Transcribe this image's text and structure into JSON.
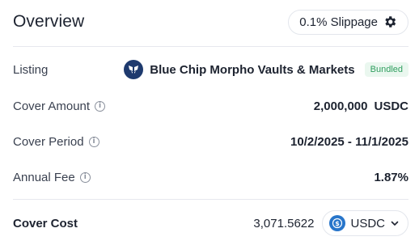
{
  "header": {
    "title": "Overview",
    "slippage_label": "0.1% Slippage"
  },
  "listing": {
    "label": "Listing",
    "name": "Blue Chip Morpho Vaults & Markets",
    "badge": "Bundled"
  },
  "cover_amount": {
    "label": "Cover Amount",
    "value": "2,000,000",
    "unit": "USDC"
  },
  "cover_period": {
    "label": "Cover Period",
    "value": "10/2/2025 - 11/1/2025"
  },
  "annual_fee": {
    "label": "Annual Fee",
    "value": "1.87%"
  },
  "cover_cost": {
    "label": "Cover Cost",
    "value": "3,071.5622",
    "token": "USDC"
  },
  "icons": {
    "slippage": "gear-icon",
    "listing": "morpho-logo-icon",
    "info": "info-icon",
    "token": "usdc-icon",
    "dropdown": "chevron-down-icon"
  },
  "colors": {
    "badge_text": "#2f9e5e",
    "badge_bg": "#eaf7ef",
    "usdc": "#2775ca",
    "morpho": "#1e3a6e"
  }
}
